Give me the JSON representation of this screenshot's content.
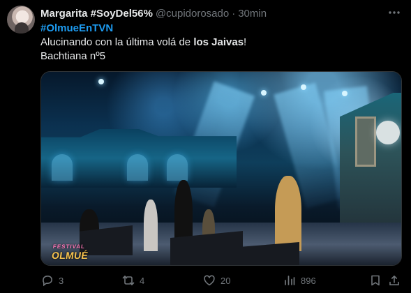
{
  "post": {
    "author_name": "Margarita #SoyDel56%",
    "handle": "@cupidorosado",
    "separator": "·",
    "time": "30min",
    "hashtag": "#OlmueEnTVN",
    "line1_prefix": "Alucinando con la última volá de ",
    "line1_bold": "los Jaivas",
    "line1_suffix": "!",
    "line2": "Bachtiana nº5",
    "media_overlay_top": "FESTIVAL",
    "media_overlay_bottom": "OLMUÉ"
  },
  "actions": {
    "reply_count": "3",
    "repost_count": "4",
    "like_count": "20",
    "views_count": "896"
  },
  "icons": {
    "avatar": "avatar",
    "more": "more-icon",
    "reply": "reply-icon",
    "repost": "repost-icon",
    "like": "like-icon",
    "views": "views-icon",
    "bookmark": "bookmark-icon",
    "share": "share-icon"
  },
  "colors": {
    "background": "#000000",
    "primary_text": "#e7e9ea",
    "secondary_text": "#71767b",
    "accent": "#1d9bf0"
  }
}
